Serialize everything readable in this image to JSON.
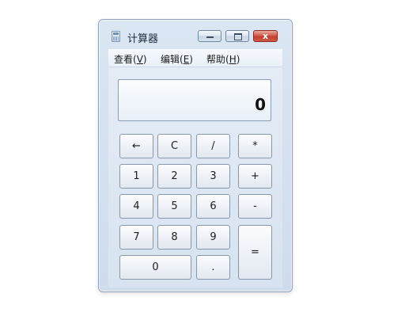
{
  "window": {
    "title": "计算器",
    "icon": "calculator-icon",
    "close_glyph": "x"
  },
  "menu": [
    {
      "label": "查看(",
      "key": "V",
      "end": ")"
    },
    {
      "label": "编辑(",
      "key": "E",
      "end": ")"
    },
    {
      "label": "帮助(",
      "key": "H",
      "end": ")"
    }
  ],
  "display": {
    "value": "0"
  },
  "keys": {
    "backspace": "←",
    "clear": "C",
    "divide": "/",
    "multiply": "*",
    "one": "1",
    "two": "2",
    "three": "3",
    "add": "+",
    "four": "4",
    "five": "5",
    "six": "6",
    "subtract": "-",
    "seven": "7",
    "eight": "8",
    "nine": "9",
    "equals": "=",
    "zero": "0",
    "decimal": "."
  },
  "colors": {
    "window_frame": "#cfdcec",
    "close_button": "#c23f2f"
  }
}
